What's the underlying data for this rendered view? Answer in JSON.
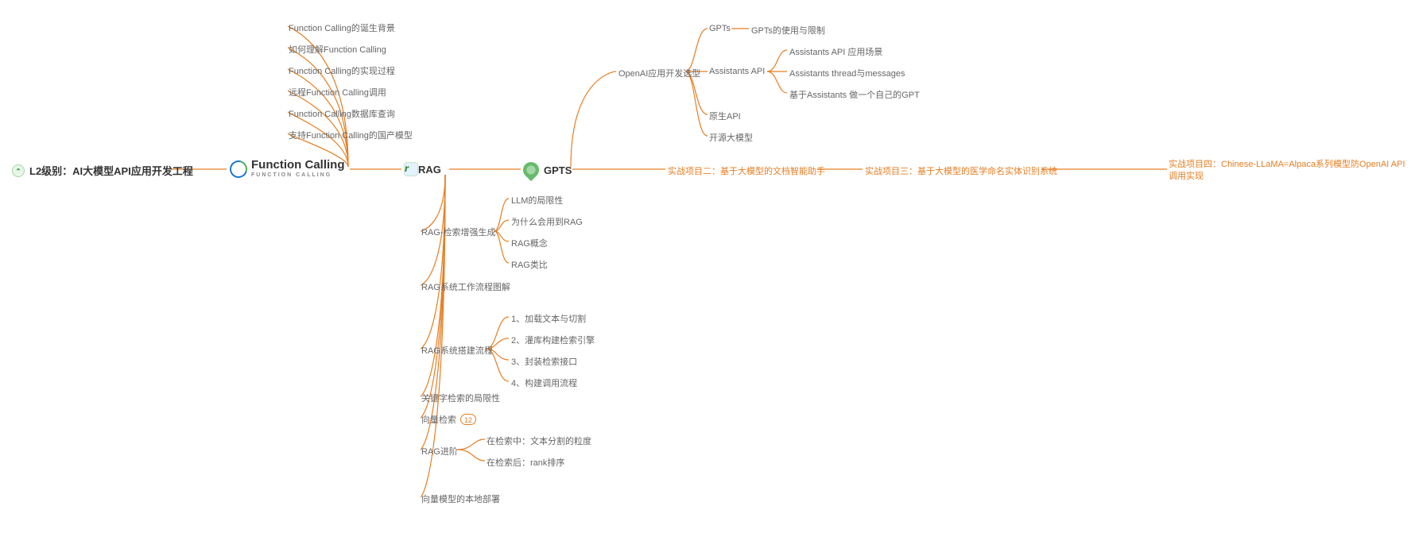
{
  "root": {
    "label": "L2级别：AI大模型API应用开发工程"
  },
  "functionCalling": {
    "label": "Function Calling",
    "sublabel": "FUNCTION CALLING",
    "children": [
      "Function Calling的诞生背景",
      "如何理解Function Calling",
      "Function Calling的实现过程",
      "远程Function Calling调用",
      "Function Calling数据库查询",
      "支持Function Calling的国产模型"
    ]
  },
  "rag": {
    "label": "RAG",
    "group1": {
      "label": "RAG-检索增强生成",
      "children": [
        "LLM的局限性",
        "为什么会用到RAG",
        "RAG概念",
        "RAG类比"
      ]
    },
    "item_flow": "RAG系统工作流程图解",
    "group2": {
      "label": "RAG系统搭建流程",
      "children": [
        "1、加载文本与切割",
        "2、灌库构建检索引擎",
        "3、封装检索接口",
        "4、构建调用流程"
      ]
    },
    "item_keyword": "关键字检索的局限性",
    "item_vector": {
      "label": "向量检索",
      "badge": "12"
    },
    "group3": {
      "label": "RAG进阶",
      "children": [
        "在检索中：文本分割的粒度",
        "在检索后：rank排序"
      ]
    },
    "item_deploy": "向量模型的本地部署"
  },
  "gpts": {
    "label": "GPTS",
    "openai": {
      "label": "OpenAI应用开发选型",
      "gpts_node": {
        "label": "GPTs",
        "child": "GPTs的使用与限制"
      },
      "assistants": {
        "label": "Assistants API",
        "children": [
          "Assistants API 应用场景",
          "Assistants thread与messages",
          "基于Assistants 做一个自己的GPT"
        ]
      },
      "native": "原生API",
      "opensource": "开源大模型"
    }
  },
  "projects": {
    "p2": "实战项目二：基于大模型的文档智能助手",
    "p3": "实战项目三：基于大模型的医学命名实体识别系统",
    "p4": "实战项目四：Chinese-LLaMA=Alpaca系列模型防OpenAI API调用实现"
  }
}
